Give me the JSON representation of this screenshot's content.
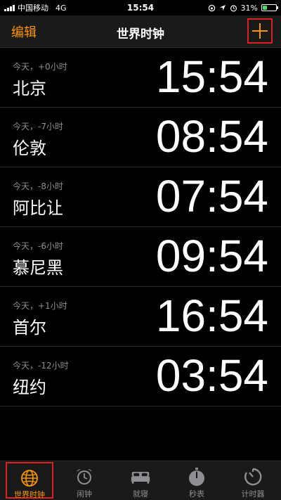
{
  "status": {
    "carrier": "中国移动",
    "network": "4G",
    "time": "15:54",
    "battery": "31%",
    "battery_level": 0.31
  },
  "nav": {
    "edit_label": "编辑",
    "title": "世界时钟"
  },
  "clocks": [
    {
      "offset": "今天，+0小时",
      "city": "北京",
      "time": "15:54"
    },
    {
      "offset": "今天，-7小时",
      "city": "伦敦",
      "time": "08:54"
    },
    {
      "offset": "今天，-8小时",
      "city": "阿比让",
      "time": "07:54"
    },
    {
      "offset": "今天，-6小时",
      "city": "慕尼黑",
      "time": "09:54"
    },
    {
      "offset": "今天，+1小时",
      "city": "首尔",
      "time": "16:54"
    },
    {
      "offset": "今天，-12小时",
      "city": "纽约",
      "time": "03:54"
    }
  ],
  "tabs": [
    {
      "label": "世界时钟",
      "icon": "globe-icon",
      "active": true
    },
    {
      "label": "闹钟",
      "icon": "alarm-clock-icon",
      "active": false
    },
    {
      "label": "就寝",
      "icon": "bed-icon",
      "active": false
    },
    {
      "label": "秒表",
      "icon": "stopwatch-icon",
      "active": false
    },
    {
      "label": "计时器",
      "icon": "timer-icon",
      "active": false
    }
  ],
  "colors": {
    "accent": "#ff9500",
    "highlight_box": "#e02020",
    "battery_fill": "#4cd964"
  }
}
